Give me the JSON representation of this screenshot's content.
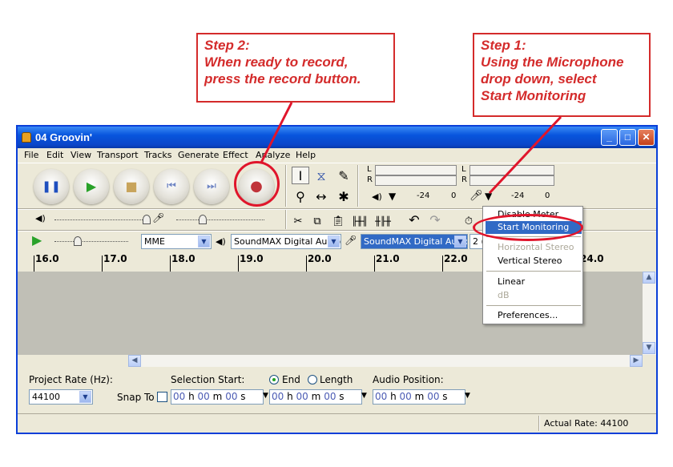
{
  "callouts": {
    "step2": {
      "line1": "Step 2:",
      "line2": "When ready to record,",
      "line3": "press the record button."
    },
    "step1": {
      "line1": "Step 1:",
      "line2": "Using the Microphone",
      "line3": "drop down, select",
      "line4": "Start Monitoring"
    }
  },
  "window": {
    "title": "04 Groovin'"
  },
  "menu": [
    "File",
    "Edit",
    "View",
    "Transport",
    "Tracks",
    "Generate",
    "Effect",
    "Analyze",
    "Help"
  ],
  "transport": {
    "buttons": [
      "pause-icon",
      "play-icon",
      "stop-icon",
      "skip-start-icon",
      "skip-end-icon",
      "record-icon"
    ]
  },
  "meters": {
    "l": "L",
    "r": "R",
    "play_tick_1": "-24",
    "play_tick_2": "0",
    "rec_tick_1": "-24",
    "rec_tick_2": "0"
  },
  "device": {
    "host": "MME",
    "output": "SoundMAX Digital Audio",
    "input": "SoundMAX Digital Audio",
    "channels": "2 ("
  },
  "ruler": [
    "16.0",
    "17.0",
    "18.0",
    "19.0",
    "20.0",
    "21.0",
    "22.0",
    "24.0"
  ],
  "mic_menu": {
    "items": [
      "Disable Meter",
      "Start Monitoring",
      "Horizontal Stereo",
      "Vertical Stereo",
      "Linear",
      "dB",
      "Preferences..."
    ],
    "highlighted": "Start Monitoring"
  },
  "selection_bar": {
    "project_rate_label": "Project Rate (Hz):",
    "project_rate": "44100",
    "snap_to": "Snap To",
    "selection_start_label": "Selection Start:",
    "end_label": "End",
    "length_label": "Length",
    "audio_position_label": "Audio Position:",
    "time_h": "00",
    "unit_h": "h",
    "time_m": "00",
    "unit_m": "m",
    "time_s": "00",
    "unit_s": "s"
  },
  "status": {
    "actual_rate": "Actual Rate: 44100"
  },
  "colors": {
    "accent": "#0a46c9",
    "callout": "#d42b2b",
    "highlight": "#316ac5",
    "record": "#c0343a"
  }
}
